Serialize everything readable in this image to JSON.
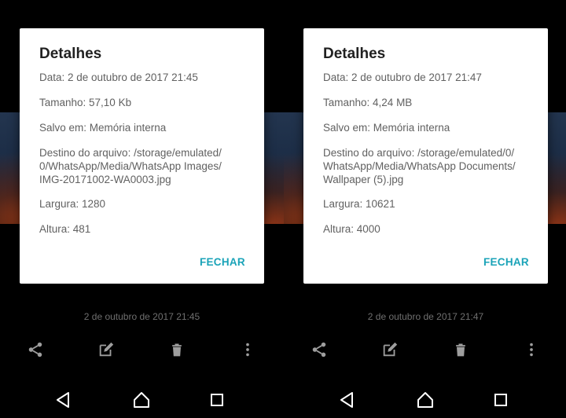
{
  "screens": [
    {
      "dialog": {
        "title": "Detalhes",
        "date": "Data: 2 de outubro de 2017 21:45",
        "size": "Tamanho: 57,10 Kb",
        "saved_in": "Salvo em: Memória interna",
        "path": "Destino do arquivo: /storage/emulated/\n0/WhatsApp/Media/WhatsApp Images/\nIMG-20171002-WA0003.jpg",
        "width": "Largura: 1280",
        "height": "Altura: 481",
        "close_label": "FECHAR"
      },
      "timestamp": "2 de outubro de 2017 21:45",
      "actions": [
        "share-icon",
        "edit-icon",
        "delete-icon",
        "more-vert-icon"
      ]
    },
    {
      "dialog": {
        "title": "Detalhes",
        "date": "Data: 2 de outubro de 2017 21:47",
        "size": "Tamanho: 4,24 MB",
        "saved_in": "Salvo em: Memória interna",
        "path": "Destino do arquivo: /storage/emulated/0/\nWhatsApp/Media/WhatsApp Documents/\nWallpaper (5).jpg",
        "width": "Largura: 10621",
        "height": "Altura: 4000",
        "close_label": "FECHAR"
      },
      "timestamp": "2 de outubro de 2017 21:47",
      "actions": [
        "share-icon",
        "edit-icon",
        "delete-icon",
        "more-vert-icon"
      ]
    }
  ],
  "navigation": [
    "back-icon",
    "home-icon",
    "recents-icon"
  ],
  "colors": {
    "accent": "#1aa3b8",
    "dialog_bg": "#ffffff",
    "screen_bg": "#000000",
    "icon": "#9e9e9e",
    "nav_icon": "#ffffff"
  }
}
